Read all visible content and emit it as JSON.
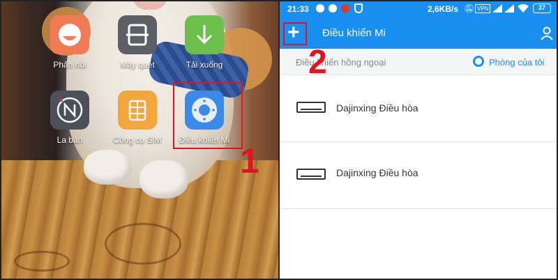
{
  "home": {
    "apps": [
      {
        "label": "Phản hồi",
        "icon": "feedback-icon",
        "color": "#ef7a54"
      },
      {
        "label": "Máy quét",
        "icon": "scanner-icon",
        "color": "#5c5f66"
      },
      {
        "label": "Tải xuống",
        "icon": "download-icon",
        "color": "#6cbf4a"
      },
      {
        "label": "La bàn",
        "icon": "compass-icon",
        "color": "#4b5059"
      },
      {
        "label": "Công cụ SIM",
        "icon": "sim-card-icon",
        "color": "#f3a63b"
      },
      {
        "label": "Điều khiển Mi",
        "icon": "mi-remote-icon",
        "color": "#3a8be8"
      }
    ],
    "step1": "1"
  },
  "status": {
    "time": "21:33",
    "speed": "2,6KB/s",
    "vpn": "VPN",
    "battery": "37"
  },
  "appbar": {
    "add": "+",
    "title": "Điều khiển Mi",
    "step2": "2"
  },
  "subbar": {
    "left_text": "Điều khiển hồng ngoại",
    "right_text": "Phòng của tôi"
  },
  "devices": [
    {
      "name": "Dajinxing Điều hòa"
    },
    {
      "name": "Dajinxing Điều hòa"
    }
  ],
  "colors": {
    "accent": "#1a8ff2",
    "highlight": "#e0141c"
  }
}
